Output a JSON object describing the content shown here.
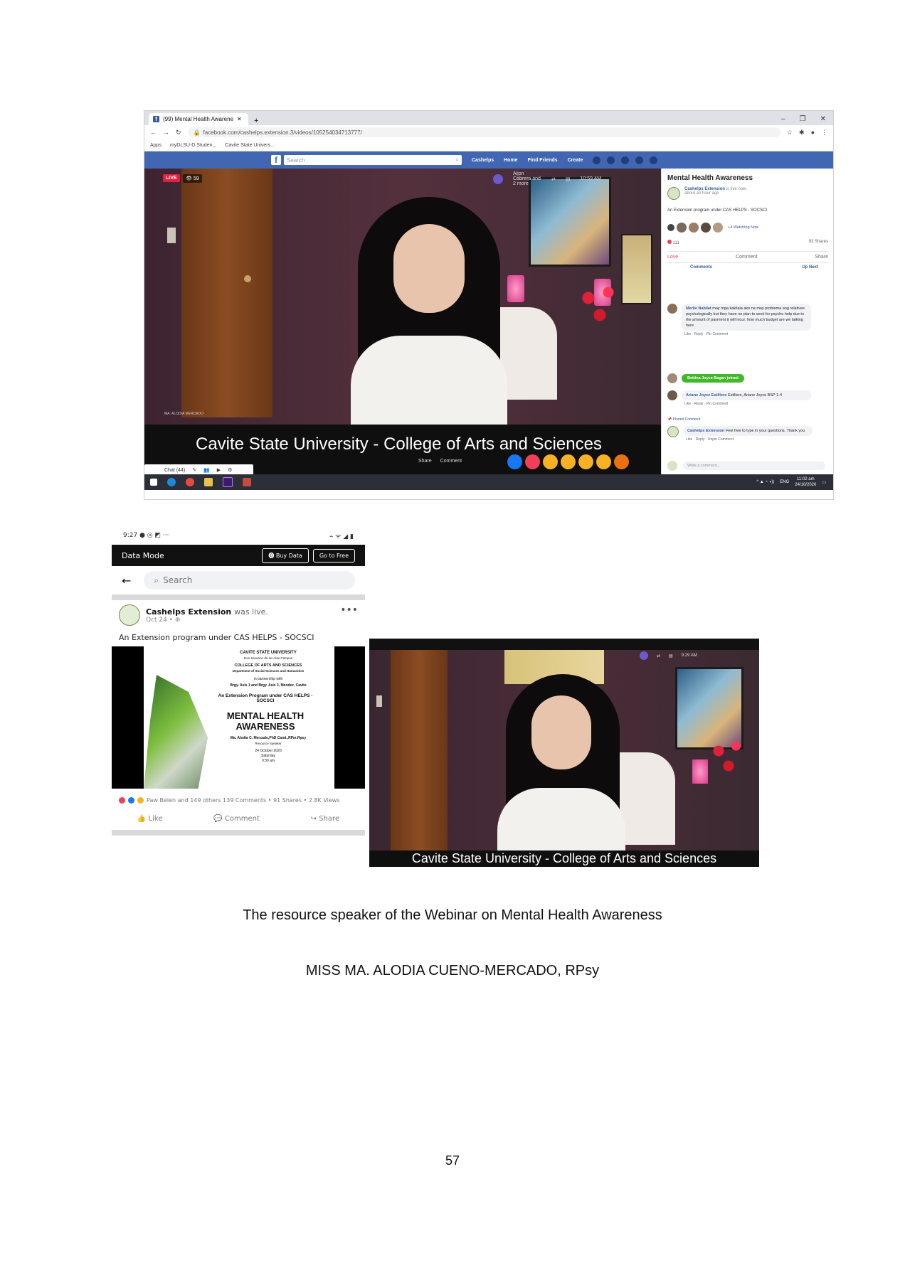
{
  "browser": {
    "tab_title": "(99) Mental Health Awarene",
    "url": "facebook.com/cashelps.extension.3/videos/105254034713777/",
    "bookmarks": [
      "Apps",
      "myDLSU-D Studen...",
      "Cavite State Univers..."
    ],
    "fb_search_placeholder": "Search",
    "fb_nav": [
      "Cashelps",
      "Home",
      "Find Friends",
      "Create"
    ]
  },
  "video_main": {
    "live_label": "LIVE",
    "viewer_count": "59",
    "host_names": "Aljon Cabrera and 2 more",
    "time": "10:59 AM",
    "speaker_tag": "MA. ALODIA MERCADO",
    "caption": "Cavite State University - College of Arts and Sciences",
    "share_label": "Share",
    "comment_label": "Comment",
    "chat_label": "Chat (44)"
  },
  "live_panel": {
    "title": "Mental Health Awareness",
    "page_name": "Cashelps Extension",
    "page_status": "is live now.",
    "posted": "about an hour ago",
    "description": "An Extension program under CAS HELPS - SOCSCI",
    "watching": "+4 Watching Now",
    "reactions_count": "111",
    "shares": "93 Shares",
    "actions": [
      "Love",
      "Comment",
      "Share"
    ],
    "tabs": [
      "Comments",
      "Up Next"
    ],
    "comments": [
      {
        "name": "Merlie Nabilat",
        "text": "may mga kakilala ako na may problema ang relatives psychologically but they have no plan to seek for psycho help due to the amount of payment it will incur. how much budget are we talking here",
        "meta": "Like · Reply · Pin Comment"
      },
      {
        "name": "Ariane Joyce Estillero",
        "text": "Estillero, Ariane Joyce BSP 1-4",
        "meta": "Like · Reply · Pin Comment"
      }
    ],
    "joined_text": "Bettina Joyce Bagan joined",
    "pinned_label": "Pinned Comment",
    "pinned_comment": {
      "name": "Cashelps Extension",
      "text": "Feel free to type in your questions. Thank you",
      "meta": "Like · Reply · Unpin Comment"
    },
    "write_placeholder": "Write a comment..."
  },
  "taskbar": {
    "time": "11:02 am",
    "date": "24/10/2020",
    "lang": "ENG"
  },
  "phone": {
    "status_time": "9:27",
    "data_mode": "Data Mode",
    "buy_data": "Buy Data",
    "go_to_free": "Go to Free",
    "search_placeholder": "Search",
    "page_name": "Cashelps Extension",
    "post_suffix": "was live.",
    "post_date": "Oct 24 •",
    "post_text": "An Extension program under CAS HELPS - SOCSCI",
    "poster": {
      "university": "CAVITE STATE UNIVERSITY",
      "campus": "Don Severino de las Alas Campus",
      "college": "COLLEGE OF ARTS AND SCIENCES",
      "department": "Department of Social Sciences and Humanities",
      "partnership": "in partnership with",
      "barangays": "Brgy. Asis 1 and Brgy. Asis 3, Mendez, Cavite",
      "program": "An Extension Program under CAS HELPS - SOCSCI",
      "topic": "MENTAL HEALTH AWARENESS",
      "speaker": "Ma. Alodia C. Mercado,PhD Cand.,RPm,Rpsy",
      "speaker_role": "Resource Speaker",
      "date": "24 October 2020",
      "day": "Saturday",
      "time": "9:30 am"
    },
    "stats": "Paw Belen and 149 others  139 Comments • 91 Shares • 2.8K Views",
    "actions": [
      "Like",
      "Comment",
      "Share"
    ]
  },
  "video_second": {
    "caption": "Cavite State University - College of Arts and Sciences",
    "time": "9:29 AM"
  },
  "doc": {
    "caption_line1": "The resource speaker of the Webinar on Mental Health Awareness",
    "caption_line2": "MISS MA. ALODIA CUENO-MERCADO, RPsy",
    "page_number": "57"
  },
  "colors": {
    "facebook_blue": "#4267b2",
    "live_red": "#e41e3f",
    "joined_green": "#42b72a"
  }
}
